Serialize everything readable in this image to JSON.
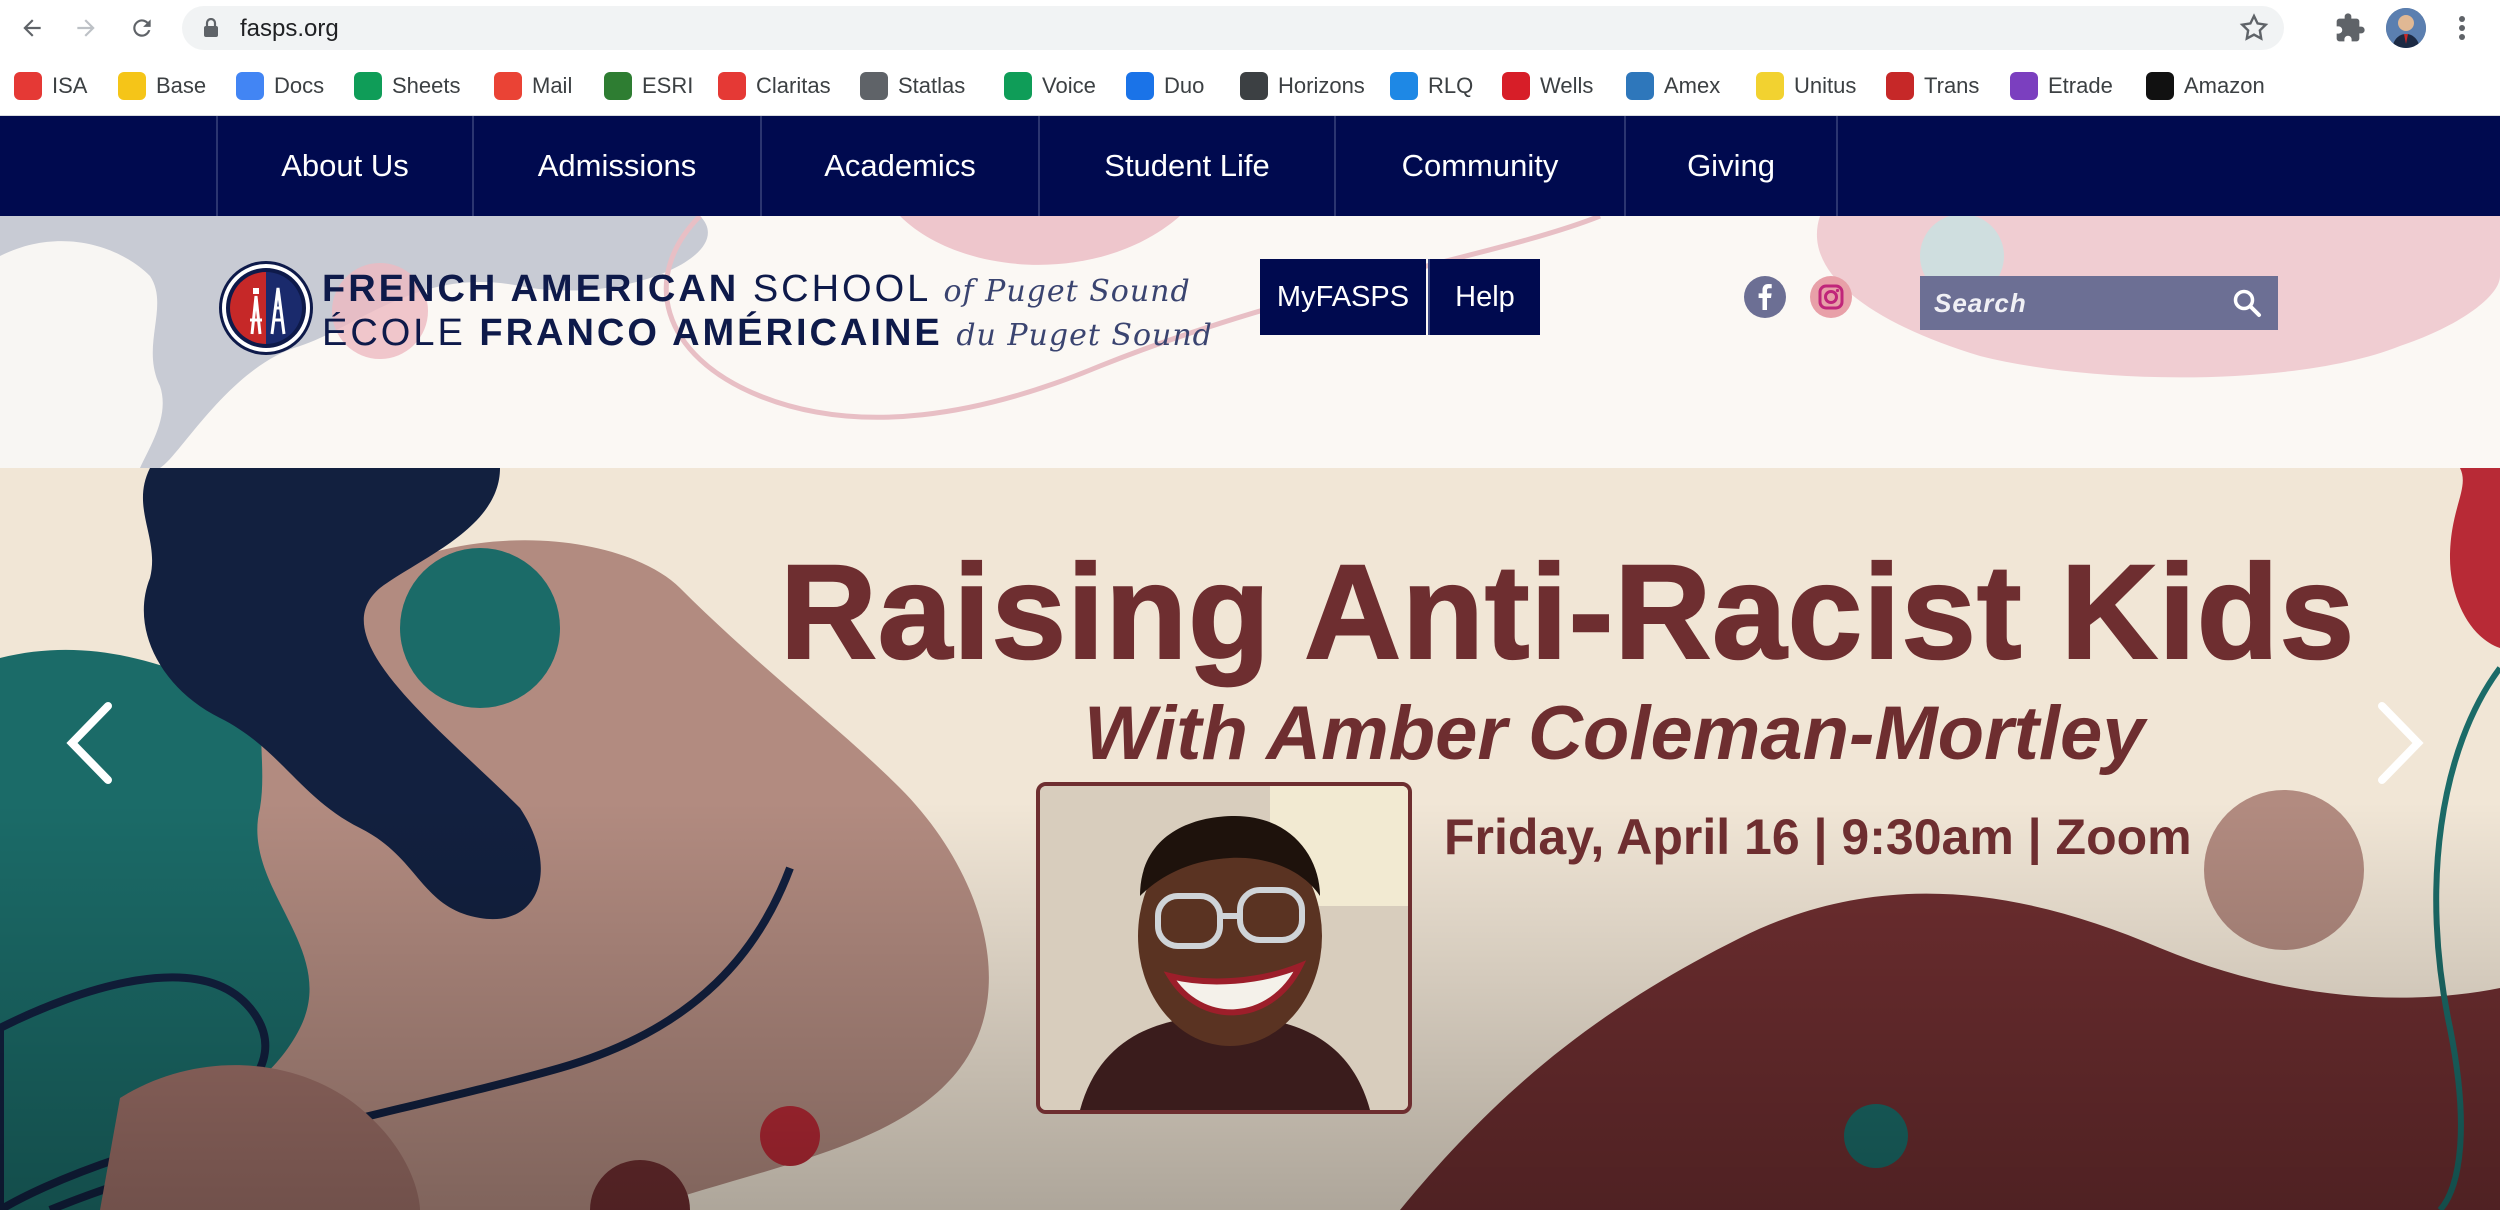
{
  "browser": {
    "url": "fasps.org",
    "bookmarks": [
      {
        "label": "ISA",
        "color": "#e53935"
      },
      {
        "label": "Base",
        "color": "#f5c518"
      },
      {
        "label": "Docs",
        "color": "#4285f4"
      },
      {
        "label": "Sheets",
        "color": "#0f9d58"
      },
      {
        "label": "Mail",
        "color": "#ea4335"
      },
      {
        "label": "ESRI",
        "color": "#2e7d32"
      },
      {
        "label": "Claritas",
        "color": "#e53935"
      },
      {
        "label": "Statlas",
        "color": "#5f6368"
      },
      {
        "label": "Voice",
        "color": "#0f9d58"
      },
      {
        "label": "Duo",
        "color": "#1a73e8"
      },
      {
        "label": "Horizons",
        "color": "#3c4043"
      },
      {
        "label": "RLQ",
        "color": "#1e88e5"
      },
      {
        "label": "Wells",
        "color": "#d71e28"
      },
      {
        "label": "Amex",
        "color": "#2e77bb"
      },
      {
        "label": "Unitus",
        "color": "#f2d230"
      },
      {
        "label": "Trans",
        "color": "#c62828"
      },
      {
        "label": "Etrade",
        "color": "#7b3fbf"
      },
      {
        "label": "Amazon",
        "color": "#111111"
      }
    ]
  },
  "nav": {
    "items": [
      "About Us",
      "Admissions",
      "Academics",
      "Student Life",
      "Community",
      "Giving"
    ]
  },
  "header": {
    "logo_line1_bold": "FRENCH AMERICAN",
    "logo_line1_light": "SCHOOL",
    "logo_line1_script": "of Puget Sound",
    "logo_line2_light": "ÉCOLE",
    "logo_line2_bold": "FRANCO AMÉRICAINE",
    "logo_line2_script": "du Puget Sound",
    "myfasps_label": "MyFASPS",
    "help_label": "Help",
    "search_placeholder": "Search",
    "social": [
      "facebook-icon",
      "instagram-icon"
    ]
  },
  "hero": {
    "title": "Raising Anti-Racist Kids",
    "subtitle": "With Amber Coleman-Mortley",
    "event": "Friday, April 16 | 9:30am | Zoom"
  },
  "colors": {
    "navy": "#000a4f",
    "maroon": "#6e2e30",
    "teal": "#1b6b68",
    "cream": "#f1e6d6"
  }
}
